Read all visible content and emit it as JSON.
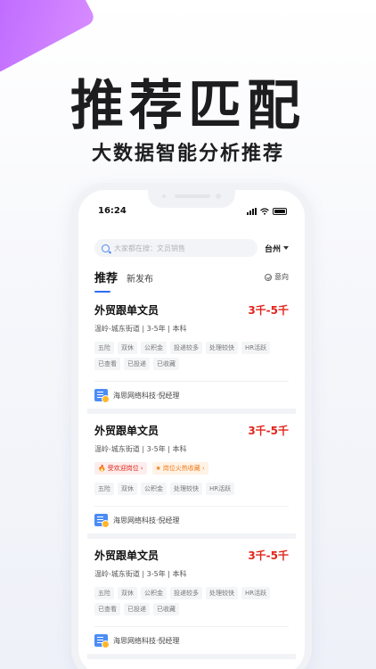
{
  "hero": {
    "title": "推荐匹配",
    "subtitle": "大数据智能分析推荐"
  },
  "status_bar": {
    "time": "16:24",
    "icons": [
      "signal-icon",
      "wifi-icon",
      "battery-icon"
    ]
  },
  "search": {
    "placeholder": "大家都在搜：文员销售",
    "city": "台州"
  },
  "tabs": {
    "recommend": "推荐",
    "new": "新发布",
    "intent": "意向"
  },
  "jobs": [
    {
      "title": "外贸跟单文员",
      "salary": "3千-5千",
      "meta": "温岭-城东街道 | 3-5年 | 本科",
      "tags": [
        "五险",
        "双休",
        "公积金",
        "投递较多",
        "处理较快",
        "HR活跃",
        "已查看",
        "已投递",
        "已收藏"
      ],
      "company": "海思网络科技·倪经理"
    },
    {
      "title": "外贸跟单文员",
      "salary": "3千-5千",
      "meta": "温岭-城东街道 | 3-5年 | 本科",
      "highlights": [
        "受欢迎岗位",
        "岗位火热收藏"
      ],
      "tags": [
        "五险",
        "双休",
        "公积金",
        "处理较快",
        "HR活跃"
      ],
      "company": "海思网络科技·倪经理"
    },
    {
      "title": "外贸跟单文员",
      "salary": "3千-5千",
      "meta": "温岭-城东街道 | 3-5年 | 本科",
      "tags": [
        "五险",
        "双休",
        "公积金",
        "投递较多",
        "处理较快",
        "HR活跃",
        "已查看",
        "已投递",
        "已收藏"
      ],
      "company": "海思网络科技·倪经理"
    }
  ],
  "colors": {
    "accent": "#2f6df6",
    "salary": "#e1251b",
    "corner": "#b35bff"
  }
}
